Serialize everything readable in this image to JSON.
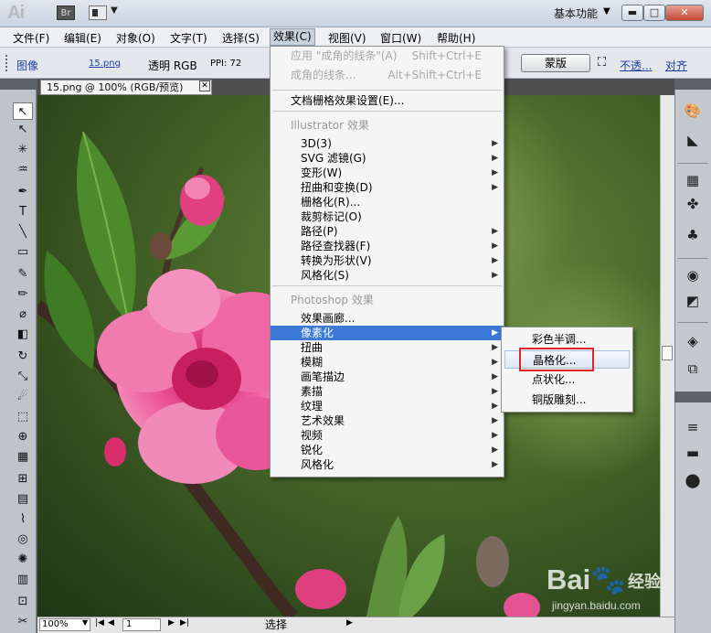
{
  "app": {
    "logo": "Ai",
    "bridge_btn": "Br",
    "workspace": "基本功能",
    "workspace_arrow": "▼",
    "layout_arrow": "▼",
    "window_buttons": {
      "minimize": "▬",
      "maximize": "□",
      "close": "✕"
    }
  },
  "menubar": {
    "items": [
      "文件(F)",
      "编辑(E)",
      "对象(O)",
      "文字(T)",
      "选择(S)",
      "效果(C)",
      "视图(V)",
      "窗口(W)",
      "帮助(H)"
    ],
    "active": "效果(C)"
  },
  "control_bar": {
    "image_label": "图像",
    "file_link": "15.png",
    "embed_info": "透明 RGB",
    "ppi": "PPI: 72",
    "mask_button": "蒙版",
    "opacity_link": "不透...",
    "align_link": "对齐",
    "crop_icon": "crop-icon"
  },
  "document": {
    "tab_title": "15.png @ 100% (RGB/预览)",
    "tab_close": "✕"
  },
  "tools": [
    {
      "name": "selection-tool-icon",
      "glyph": "↖",
      "selected": true
    },
    {
      "name": "direct-selection-tool-icon",
      "glyph": "↖"
    },
    {
      "name": "magic-wand-tool-icon",
      "glyph": "✳"
    },
    {
      "name": "lasso-tool-icon",
      "glyph": "♒"
    },
    {
      "name": "pen-tool-icon",
      "glyph": "✒"
    },
    {
      "name": "type-tool-icon",
      "glyph": "T"
    },
    {
      "name": "line-segment-tool-icon",
      "glyph": "╲"
    },
    {
      "name": "rectangle-tool-icon",
      "glyph": "▭"
    },
    {
      "name": "paintbrush-tool-icon",
      "glyph": "✎"
    },
    {
      "name": "pencil-tool-icon",
      "glyph": "✏"
    },
    {
      "name": "blob-brush-tool-icon",
      "glyph": "⌀"
    },
    {
      "name": "eraser-tool-icon",
      "glyph": "◧"
    },
    {
      "name": "rotate-tool-icon",
      "glyph": "↻"
    },
    {
      "name": "scale-tool-icon",
      "glyph": "⤡"
    },
    {
      "name": "warp-tool-icon",
      "glyph": "☄"
    },
    {
      "name": "free-transform-tool-icon",
      "glyph": "⬚"
    },
    {
      "name": "shape-builder-tool-icon",
      "glyph": "⊕"
    },
    {
      "name": "perspective-grid-tool-icon",
      "glyph": "▦"
    },
    {
      "name": "mesh-tool-icon",
      "glyph": "⊞"
    },
    {
      "name": "gradient-tool-icon",
      "glyph": "▤"
    },
    {
      "name": "eyedropper-tool-icon",
      "glyph": "⌇"
    },
    {
      "name": "blend-tool-icon",
      "glyph": "◎"
    },
    {
      "name": "symbol-sprayer-tool-icon",
      "glyph": "✺"
    },
    {
      "name": "column-graph-tool-icon",
      "glyph": "▥"
    },
    {
      "name": "artboard-tool-icon",
      "glyph": "⊡"
    },
    {
      "name": "slice-tool-icon",
      "glyph": "✂"
    },
    {
      "name": "hand-tool-icon",
      "glyph": "✋"
    }
  ],
  "effect_menu": {
    "items": [
      {
        "label": "应用 \"成角的线条\"(A)",
        "shortcut": "Shift+Ctrl+E",
        "disabled": true
      },
      {
        "label": "成角的线条...",
        "shortcut": "Alt+Shift+Ctrl+E",
        "disabled": true
      },
      {
        "sep": true
      },
      {
        "label": "文档栅格效果设置(E)..."
      },
      {
        "sep": true
      },
      {
        "label": "Illustrator 效果",
        "header": true
      },
      {
        "label": "3D(3)",
        "arrow": true
      },
      {
        "label": "SVG 滤镜(G)",
        "arrow": true
      },
      {
        "label": "变形(W)",
        "arrow": true
      },
      {
        "label": "扭曲和变换(D)",
        "arrow": true
      },
      {
        "label": "栅格化(R)..."
      },
      {
        "label": "裁剪标记(O)"
      },
      {
        "label": "路径(P)",
        "arrow": true
      },
      {
        "label": "路径查找器(F)",
        "arrow": true
      },
      {
        "label": "转换为形状(V)",
        "arrow": true
      },
      {
        "label": "风格化(S)",
        "arrow": true
      },
      {
        "sep": true
      },
      {
        "label": "Photoshop 效果",
        "header": true
      },
      {
        "label": "效果画廊..."
      },
      {
        "label": "像素化",
        "arrow": true,
        "highlight": true
      },
      {
        "label": "扭曲",
        "arrow": true
      },
      {
        "label": "模糊",
        "arrow": true
      },
      {
        "label": "画笔描边",
        "arrow": true
      },
      {
        "label": "素描",
        "arrow": true
      },
      {
        "label": "纹理",
        "arrow": true
      },
      {
        "label": "艺术效果",
        "arrow": true
      },
      {
        "label": "视频",
        "arrow": true
      },
      {
        "label": "锐化",
        "arrow": true
      },
      {
        "label": "风格化",
        "arrow": true
      }
    ],
    "arrow_glyph": "▶"
  },
  "pixelate_submenu": {
    "items": [
      {
        "label": "彩色半调..."
      },
      {
        "label": "晶格化...",
        "hover": true,
        "annotated": true
      },
      {
        "label": "点状化..."
      },
      {
        "label": "铜版雕刻..."
      }
    ]
  },
  "statusbar": {
    "zoom": "100%",
    "page": "1",
    "status": "选择",
    "first": "|◀",
    "prev": "◀",
    "next": "▶",
    "last": "▶|",
    "dropdown": "▼"
  },
  "right_panels": [
    {
      "name": "color-panel-icon",
      "glyph": "🎨"
    },
    {
      "name": "color-guide-panel-icon",
      "glyph": "◣"
    },
    {
      "name": "swatches-panel-icon",
      "glyph": "▦"
    },
    {
      "name": "brushes-panel-icon",
      "glyph": "✤"
    },
    {
      "name": "symbols-panel-icon",
      "glyph": "♣"
    },
    {
      "name": "stroke-panel-icon",
      "glyph": "◉"
    },
    {
      "name": "transparency-panel-icon",
      "glyph": "◩"
    },
    {
      "name": "layers-panel-icon",
      "glyph": "◈"
    },
    {
      "name": "artboards-panel-icon",
      "glyph": "⧉"
    },
    {
      "name": "align-panel-icon",
      "glyph": "≡"
    },
    {
      "name": "gradient-panel-icon",
      "glyph": "▬"
    },
    {
      "name": "pathfinder-panel-icon",
      "glyph": "⬤"
    }
  ],
  "watermark": {
    "logo": "Bai🐾",
    "word": "经验",
    "url": "jingyan.baidu.com"
  },
  "colors": {
    "menu_highlight": "#3c79d6",
    "annotation_red": "#e0262b",
    "flower_pink": "#f06aa8"
  }
}
